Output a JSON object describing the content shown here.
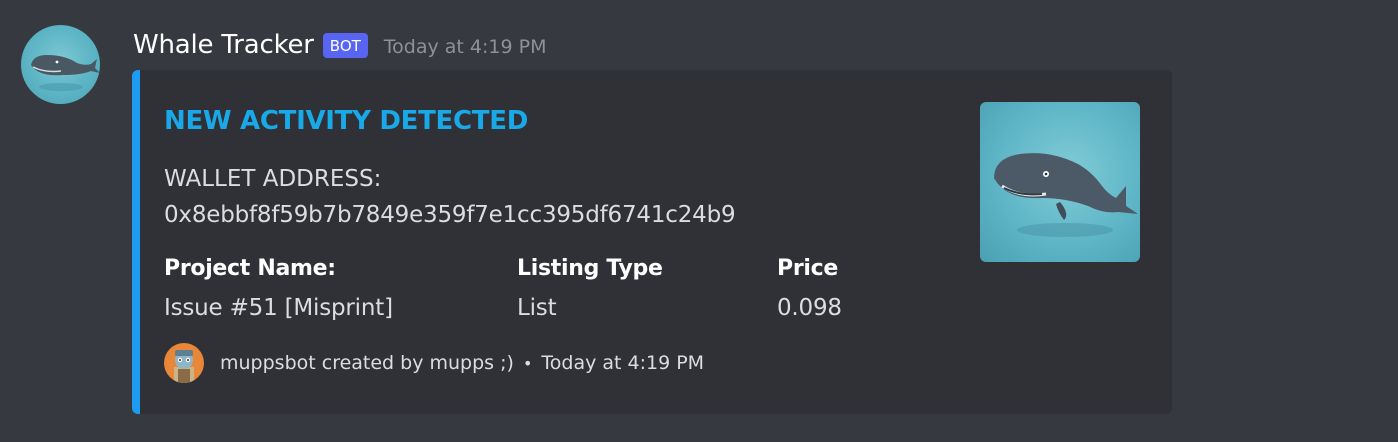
{
  "message": {
    "username": "Whale Tracker",
    "badge": "BOT",
    "timestamp": "Today at 4:19 PM",
    "avatar_icon": "whale-avatar-icon"
  },
  "embed": {
    "accent_color": "#1d9bf0",
    "title": "NEW ACTIVITY DETECTED",
    "description_label": "WALLET ADDRESS:",
    "description_value": "0x8ebbf8f59b7b7849e359f7e1cc395df6741c24b9",
    "fields": [
      {
        "name": "Project Name:",
        "value": "Issue #51 [Misprint]"
      },
      {
        "name": "Listing Type",
        "value": "List"
      },
      {
        "name": "Price",
        "value": "0.098"
      }
    ],
    "footer": {
      "text": "muppsbot created by mupps ;)",
      "separator": "•",
      "timestamp": "Today at 4:19 PM",
      "icon": "muppsbot-footer-icon"
    },
    "thumbnail_icon": "whale-thumbnail-icon"
  },
  "colors": {
    "background": "#36393f",
    "embed_background": "#2f3136",
    "title": "#19a8e8",
    "badge": "#5865f2"
  }
}
